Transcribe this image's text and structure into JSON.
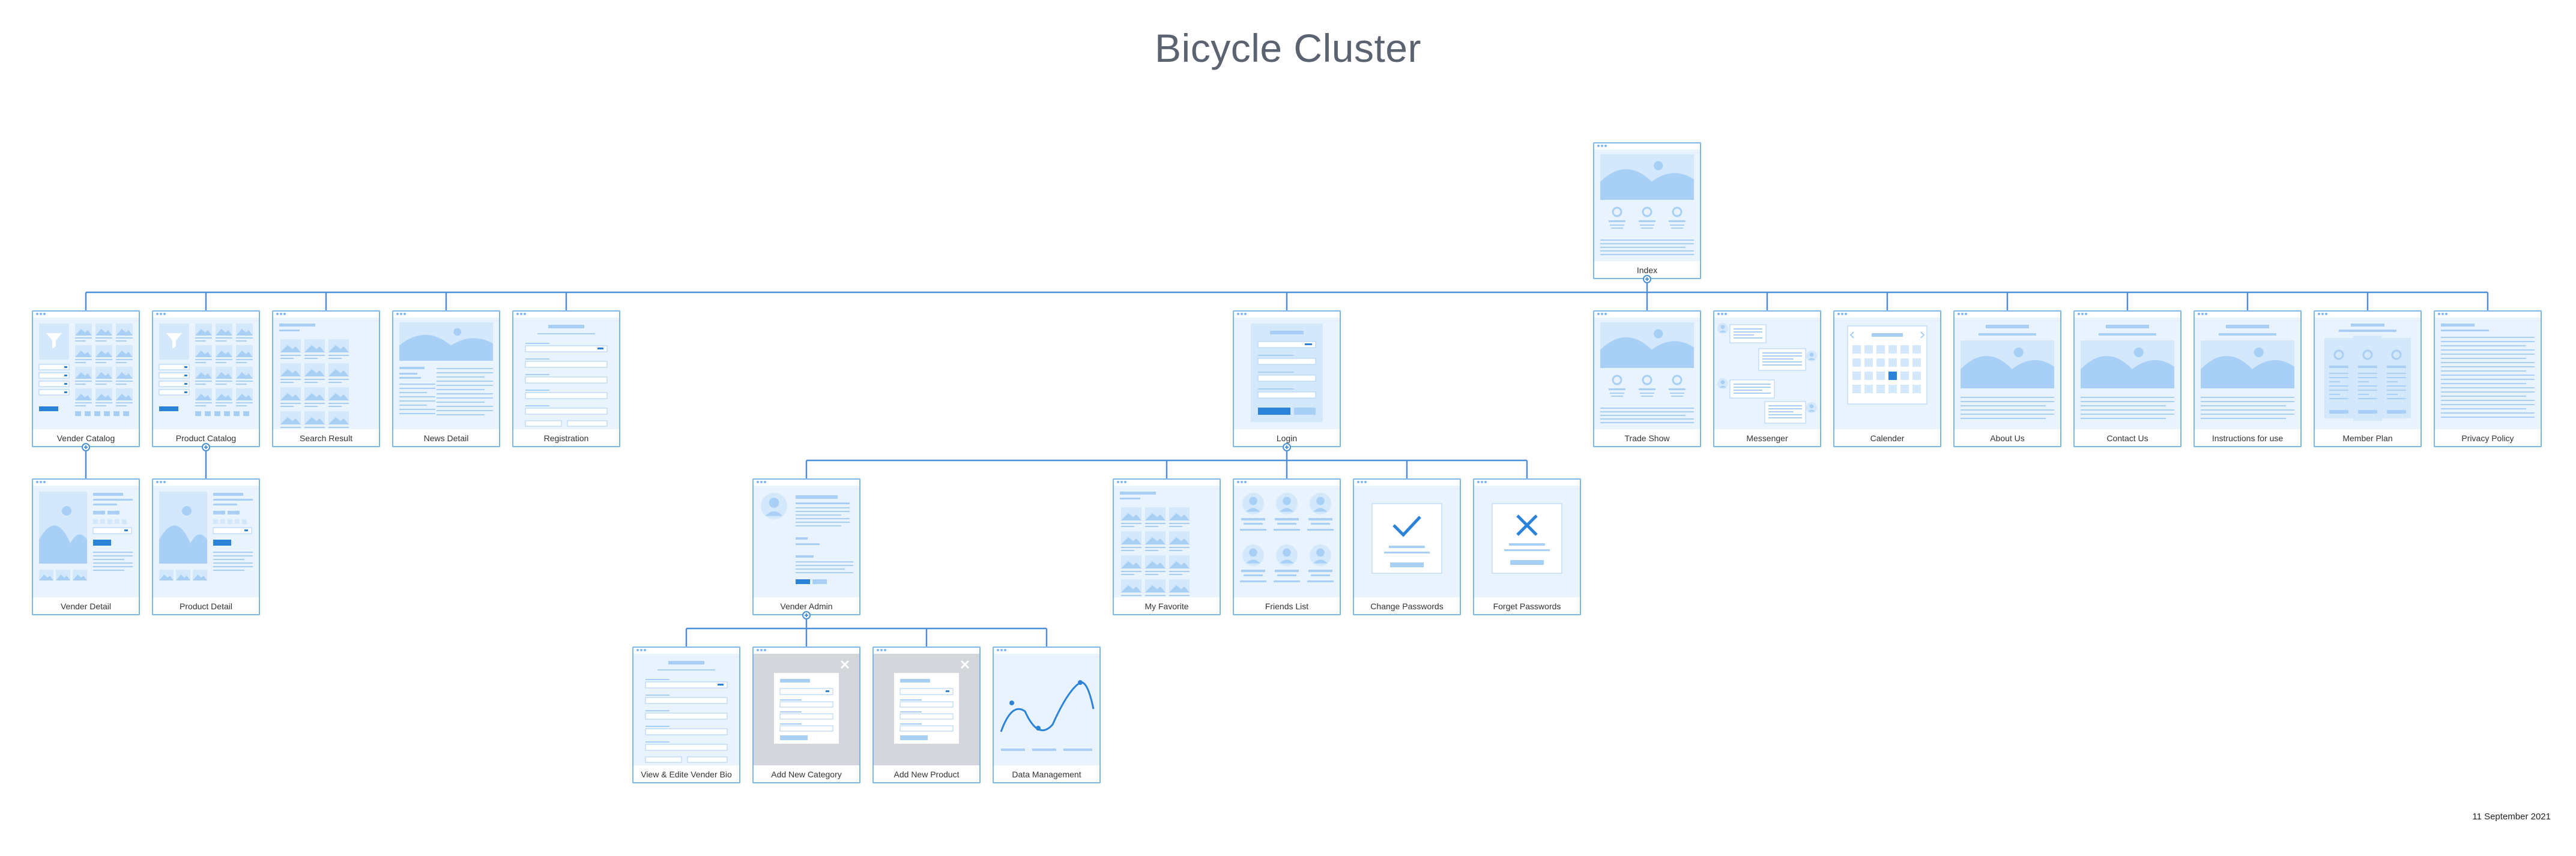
{
  "diagram": {
    "title": "Bicycle Cluster",
    "date": "11 September 2021"
  },
  "colors": {
    "connector": "#4a90d9",
    "card_border": "#7fb6ea",
    "wireframe_fill": "#e9f3fd",
    "wireframe_shape": "#a8cff5",
    "accent": "#2b82d9",
    "modal_backdrop": "#d3d7dc"
  },
  "pages": {
    "index": {
      "label": "Index",
      "icon": "landing-wireframe-icon"
    },
    "vender_catalog": {
      "label": "Vender Catalog",
      "icon": "catalog-filter-wireframe-icon"
    },
    "product_catalog": {
      "label": "Product Catalog",
      "icon": "catalog-filter-wireframe-icon"
    },
    "search_result": {
      "label": "Search Result",
      "icon": "grid-results-wireframe-icon"
    },
    "news_detail": {
      "label": "News Detail",
      "icon": "article-wireframe-icon"
    },
    "registration": {
      "label": "Registration",
      "icon": "form-wireframe-icon"
    },
    "login": {
      "label": "Login",
      "icon": "login-form-wireframe-icon"
    },
    "trade_show": {
      "label": "Trade Show",
      "icon": "landing-wireframe-icon"
    },
    "messenger": {
      "label": "Messenger",
      "icon": "chat-wireframe-icon"
    },
    "calender": {
      "label": "Calender",
      "icon": "calendar-wireframe-icon"
    },
    "about_us": {
      "label": "About Us",
      "icon": "hero-image-wireframe-icon"
    },
    "contact_us": {
      "label": "Contact Us",
      "icon": "hero-image-wireframe-icon"
    },
    "instructions": {
      "label": "Instructions for use",
      "icon": "hero-image-wireframe-icon"
    },
    "member_plan": {
      "label": "Member Plan",
      "icon": "pricing-columns-wireframe-icon"
    },
    "privacy_policy": {
      "label": "Privacy Policy",
      "icon": "text-document-wireframe-icon"
    },
    "vender_detail": {
      "label": "Vender Detail",
      "icon": "product-detail-wireframe-icon"
    },
    "product_detail": {
      "label": "Product Detail",
      "icon": "product-detail-wireframe-icon"
    },
    "vender_admin": {
      "label": "Vender Admin",
      "icon": "profile-wireframe-icon"
    },
    "my_favorite": {
      "label": "My Favorite",
      "icon": "grid-results-wireframe-icon"
    },
    "friends_list": {
      "label": "Friends List",
      "icon": "user-grid-wireframe-icon"
    },
    "change_passwords": {
      "label": "Change Passwords",
      "icon": "checkmark-wireframe-icon"
    },
    "forget_passwords": {
      "label": "Forget Passwords",
      "icon": "cross-wireframe-icon"
    },
    "view_edit_bio": {
      "label": "View & Edite Vender Bio",
      "icon": "form-wireframe-icon"
    },
    "add_new_category": {
      "label": "Add New Category",
      "icon": "modal-form-wireframe-icon"
    },
    "add_new_product": {
      "label": "Add New Product",
      "icon": "modal-form-wireframe-icon"
    },
    "data_management": {
      "label": "Data Management",
      "icon": "line-chart-wireframe-icon"
    }
  },
  "hierarchy": [
    {
      "parent": "index",
      "children": [
        "vender_catalog",
        "product_catalog",
        "search_result",
        "news_detail",
        "registration",
        "login",
        "trade_show",
        "messenger",
        "calender",
        "about_us",
        "contact_us",
        "instructions",
        "member_plan",
        "privacy_policy"
      ]
    },
    {
      "parent": "vender_catalog",
      "children": [
        "vender_detail"
      ]
    },
    {
      "parent": "product_catalog",
      "children": [
        "product_detail"
      ]
    },
    {
      "parent": "login",
      "children": [
        "vender_admin",
        "my_favorite",
        "friends_list",
        "change_passwords",
        "forget_passwords"
      ]
    },
    {
      "parent": "vender_admin",
      "children": [
        "view_edit_bio",
        "add_new_category",
        "add_new_product",
        "data_management"
      ]
    }
  ]
}
